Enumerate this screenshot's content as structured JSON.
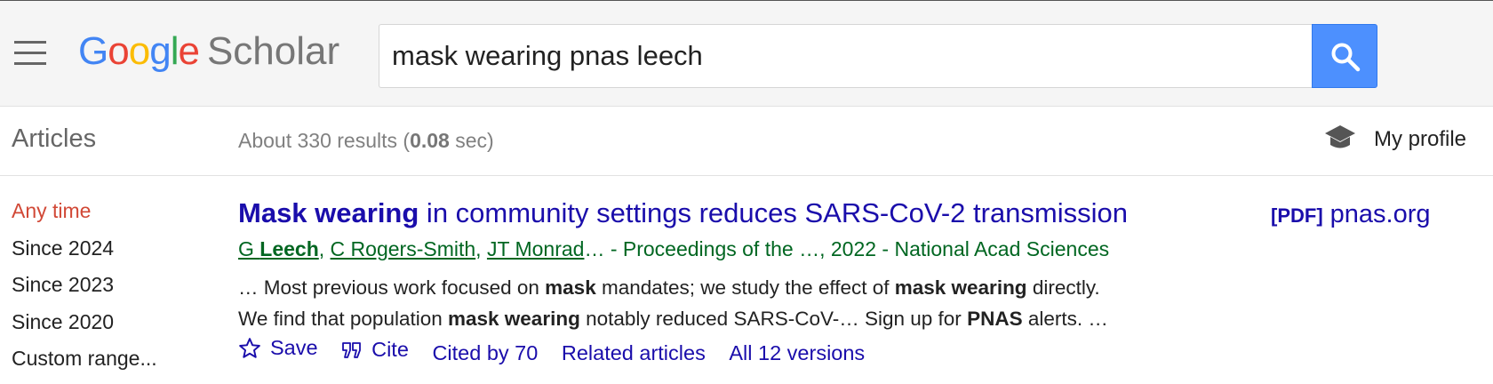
{
  "header": {
    "logo": {
      "google": [
        "G",
        "o",
        "o",
        "g",
        "l",
        "e"
      ],
      "scholar": "Scholar",
      "colors": [
        "#4285f4",
        "#ea4335",
        "#fbbc05",
        "#4285f4",
        "#34a853",
        "#ea4335"
      ]
    },
    "search": {
      "value": "mask wearing pnas leech",
      "button_icon": "search-icon"
    },
    "menu_icon": "hamburger-menu-icon"
  },
  "subbar": {
    "section": "Articles",
    "results_prefix": "About 330 results (",
    "results_time": "0.08",
    "results_suffix": " sec)",
    "profile_label": "My profile",
    "profile_icon": "graduation-cap-icon"
  },
  "timefilter": [
    "Any time",
    "Since 2024",
    "Since 2023",
    "Since 2020",
    "Custom range..."
  ],
  "result": {
    "title_bold": "Mask wearing",
    "title_rest": " in community settings reduces SARS-CoV-2 transmission",
    "authors": [
      {
        "prefix": "G ",
        "bold": "Leech"
      },
      {
        "prefix": "C Rogers-Smith",
        "bold": ""
      },
      {
        "prefix": "JT Monrad",
        "bold": ""
      }
    ],
    "author_sep": ", ",
    "source": "… - Proceedings of the …, 2022 - National Acad Sciences",
    "snippet_line1": [
      {
        "t": "… Most previous work focused on ",
        "b": false
      },
      {
        "t": "mask",
        "b": true
      },
      {
        "t": " mandates; we study the effect of ",
        "b": false
      },
      {
        "t": "mask wearing",
        "b": true
      },
      {
        "t": " directly.",
        "b": false
      }
    ],
    "snippet_line2": [
      {
        "t": "We find that population ",
        "b": false
      },
      {
        "t": "mask wearing",
        "b": true
      },
      {
        "t": " notably reduced SARS-CoV-… Sign up for ",
        "b": false
      },
      {
        "t": "PNAS",
        "b": true
      },
      {
        "t": " alerts. …",
        "b": false
      }
    ],
    "actions": {
      "save": "Save",
      "cite": "Cite",
      "cited_by": "Cited by 70",
      "related": "Related articles",
      "versions": "All 12 versions"
    },
    "pdf_tag": "[PDF]",
    "pdf_source": "pnas.org"
  },
  "colors": {
    "link": "#1a0dab",
    "source_green": "#006621",
    "active_filter": "#d14836",
    "search_button": "#4d90fe"
  }
}
